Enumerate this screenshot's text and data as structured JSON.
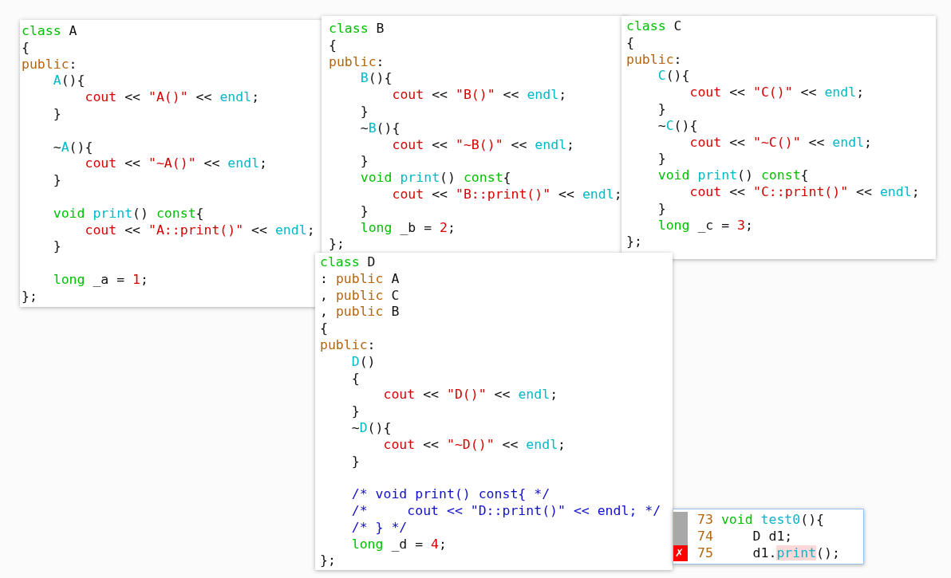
{
  "panels": [
    {
      "kind": "code",
      "lines": [
        {
          "kind": "code",
          "tokens": [
            {
              "kind": "kw",
              "text": "class"
            },
            {
              "kind": "pl",
              "text": " A"
            }
          ]
        },
        {
          "kind": "code",
          "tokens": [
            {
              "kind": "pl",
              "text": "{"
            }
          ]
        },
        {
          "kind": "code",
          "tokens": [
            {
              "kind": "acc",
              "text": "public"
            },
            {
              "kind": "pl",
              "text": ":"
            }
          ]
        },
        {
          "kind": "code",
          "tokens": [
            {
              "kind": "fn",
              "text": "    A"
            },
            {
              "kind": "pl",
              "text": "(){"
            }
          ]
        },
        {
          "kind": "code",
          "tokens": [
            {
              "kind": "str",
              "text": "        cout"
            },
            {
              "kind": "pl",
              "text": " << "
            },
            {
              "kind": "str",
              "text": "\"A()\""
            },
            {
              "kind": "pl",
              "text": " << "
            },
            {
              "kind": "fn",
              "text": "endl"
            },
            {
              "kind": "pl",
              "text": ";"
            }
          ]
        },
        {
          "kind": "code",
          "tokens": [
            {
              "kind": "pl",
              "text": "    }"
            }
          ]
        },
        {
          "kind": "blank"
        },
        {
          "kind": "code",
          "tokens": [
            {
              "kind": "pl",
              "text": "    ~"
            },
            {
              "kind": "fn",
              "text": "A"
            },
            {
              "kind": "pl",
              "text": "(){"
            }
          ]
        },
        {
          "kind": "code",
          "tokens": [
            {
              "kind": "str",
              "text": "        cout"
            },
            {
              "kind": "pl",
              "text": " << "
            },
            {
              "kind": "str",
              "text": "\"~A()\""
            },
            {
              "kind": "pl",
              "text": " << "
            },
            {
              "kind": "fn",
              "text": "endl"
            },
            {
              "kind": "pl",
              "text": ";"
            }
          ]
        },
        {
          "kind": "code",
          "tokens": [
            {
              "kind": "pl",
              "text": "    }"
            }
          ]
        },
        {
          "kind": "blank"
        },
        {
          "kind": "code",
          "tokens": [
            {
              "kind": "kw",
              "text": "    void "
            },
            {
              "kind": "fn",
              "text": "print"
            },
            {
              "kind": "pl",
              "text": "() "
            },
            {
              "kind": "kw",
              "text": "const"
            },
            {
              "kind": "pl",
              "text": "{"
            }
          ]
        },
        {
          "kind": "code",
          "tokens": [
            {
              "kind": "str",
              "text": "        cout"
            },
            {
              "kind": "pl",
              "text": " << "
            },
            {
              "kind": "str",
              "text": "\"A::print()\""
            },
            {
              "kind": "pl",
              "text": " << "
            },
            {
              "kind": "fn",
              "text": "endl"
            },
            {
              "kind": "pl",
              "text": ";"
            }
          ]
        },
        {
          "kind": "code",
          "tokens": [
            {
              "kind": "pl",
              "text": "    }"
            }
          ]
        },
        {
          "kind": "blank"
        },
        {
          "kind": "code",
          "tokens": [
            {
              "kind": "kw",
              "text": "    long"
            },
            {
              "kind": "pl",
              "text": " _a = "
            },
            {
              "kind": "str",
              "text": "1"
            },
            {
              "kind": "pl",
              "text": ";"
            }
          ]
        },
        {
          "kind": "code",
          "tokens": [
            {
              "kind": "pl",
              "text": "};"
            }
          ]
        }
      ]
    },
    {
      "kind": "code",
      "lines": [
        {
          "kind": "code",
          "tokens": [
            {
              "kind": "kw",
              "text": "class"
            },
            {
              "kind": "pl",
              "text": " B"
            }
          ]
        },
        {
          "kind": "code",
          "tokens": [
            {
              "kind": "pl",
              "text": "{"
            }
          ]
        },
        {
          "kind": "code",
          "tokens": [
            {
              "kind": "acc",
              "text": "public"
            },
            {
              "kind": "pl",
              "text": ":"
            }
          ]
        },
        {
          "kind": "code",
          "tokens": [
            {
              "kind": "fn",
              "text": "    B"
            },
            {
              "kind": "pl",
              "text": "(){"
            }
          ]
        },
        {
          "kind": "code",
          "tokens": [
            {
              "kind": "str",
              "text": "        cout"
            },
            {
              "kind": "pl",
              "text": " << "
            },
            {
              "kind": "str",
              "text": "\"B()\""
            },
            {
              "kind": "pl",
              "text": " << "
            },
            {
              "kind": "fn",
              "text": "endl"
            },
            {
              "kind": "pl",
              "text": ";"
            }
          ]
        },
        {
          "kind": "code",
          "tokens": [
            {
              "kind": "pl",
              "text": "    }"
            }
          ]
        },
        {
          "kind": "code",
          "tokens": [
            {
              "kind": "pl",
              "text": "    ~"
            },
            {
              "kind": "fn",
              "text": "B"
            },
            {
              "kind": "pl",
              "text": "(){"
            }
          ]
        },
        {
          "kind": "code",
          "tokens": [
            {
              "kind": "str",
              "text": "        cout"
            },
            {
              "kind": "pl",
              "text": " << "
            },
            {
              "kind": "str",
              "text": "\"~B()\""
            },
            {
              "kind": "pl",
              "text": " << "
            },
            {
              "kind": "fn",
              "text": "endl"
            },
            {
              "kind": "pl",
              "text": ";"
            }
          ]
        },
        {
          "kind": "code",
          "tokens": [
            {
              "kind": "pl",
              "text": "    }"
            }
          ]
        },
        {
          "kind": "code",
          "tokens": [
            {
              "kind": "kw",
              "text": "    void "
            },
            {
              "kind": "fn",
              "text": "print"
            },
            {
              "kind": "pl",
              "text": "() "
            },
            {
              "kind": "kw",
              "text": "const"
            },
            {
              "kind": "pl",
              "text": "{"
            }
          ]
        },
        {
          "kind": "code",
          "tokens": [
            {
              "kind": "str",
              "text": "        cout"
            },
            {
              "kind": "pl",
              "text": " << "
            },
            {
              "kind": "str",
              "text": "\"B::print()\""
            },
            {
              "kind": "pl",
              "text": " << "
            },
            {
              "kind": "fn",
              "text": "endl"
            },
            {
              "kind": "pl",
              "text": ";"
            }
          ]
        },
        {
          "kind": "code",
          "tokens": [
            {
              "kind": "pl",
              "text": "    }"
            }
          ]
        },
        {
          "kind": "code",
          "tokens": [
            {
              "kind": "kw",
              "text": "    long"
            },
            {
              "kind": "pl",
              "text": " _b = "
            },
            {
              "kind": "str",
              "text": "2"
            },
            {
              "kind": "pl",
              "text": ";"
            }
          ]
        },
        {
          "kind": "code",
          "tokens": [
            {
              "kind": "pl",
              "text": "};"
            }
          ]
        }
      ]
    },
    {
      "kind": "code",
      "lines": [
        {
          "kind": "code",
          "tokens": [
            {
              "kind": "kw",
              "text": "class"
            },
            {
              "kind": "pl",
              "text": " C"
            }
          ]
        },
        {
          "kind": "code",
          "tokens": [
            {
              "kind": "pl",
              "text": "{"
            }
          ]
        },
        {
          "kind": "code",
          "tokens": [
            {
              "kind": "acc",
              "text": "public"
            },
            {
              "kind": "pl",
              "text": ":"
            }
          ]
        },
        {
          "kind": "code",
          "tokens": [
            {
              "kind": "fn",
              "text": "    C"
            },
            {
              "kind": "pl",
              "text": "(){"
            }
          ]
        },
        {
          "kind": "code",
          "tokens": [
            {
              "kind": "str",
              "text": "        cout"
            },
            {
              "kind": "pl",
              "text": " << "
            },
            {
              "kind": "str",
              "text": "\"C()\""
            },
            {
              "kind": "pl",
              "text": " << "
            },
            {
              "kind": "fn",
              "text": "endl"
            },
            {
              "kind": "pl",
              "text": ";"
            }
          ]
        },
        {
          "kind": "code",
          "tokens": [
            {
              "kind": "pl",
              "text": "    }"
            }
          ]
        },
        {
          "kind": "code",
          "tokens": [
            {
              "kind": "pl",
              "text": "    ~"
            },
            {
              "kind": "fn",
              "text": "C"
            },
            {
              "kind": "pl",
              "text": "(){"
            }
          ]
        },
        {
          "kind": "code",
          "tokens": [
            {
              "kind": "str",
              "text": "        cout"
            },
            {
              "kind": "pl",
              "text": " << "
            },
            {
              "kind": "str",
              "text": "\"~C()\""
            },
            {
              "kind": "pl",
              "text": " << "
            },
            {
              "kind": "fn",
              "text": "endl"
            },
            {
              "kind": "pl",
              "text": ";"
            }
          ]
        },
        {
          "kind": "code",
          "tokens": [
            {
              "kind": "pl",
              "text": "    }"
            }
          ]
        },
        {
          "kind": "code",
          "tokens": [
            {
              "kind": "kw",
              "text": "    void "
            },
            {
              "kind": "fn",
              "text": "print"
            },
            {
              "kind": "pl",
              "text": "() "
            },
            {
              "kind": "kw",
              "text": "const"
            },
            {
              "kind": "pl",
              "text": "{"
            }
          ]
        },
        {
          "kind": "code",
          "tokens": [
            {
              "kind": "str",
              "text": "        cout"
            },
            {
              "kind": "pl",
              "text": " << "
            },
            {
              "kind": "str",
              "text": "\"C::print()\""
            },
            {
              "kind": "pl",
              "text": " << "
            },
            {
              "kind": "fn",
              "text": "endl"
            },
            {
              "kind": "pl",
              "text": ";"
            }
          ]
        },
        {
          "kind": "code",
          "tokens": [
            {
              "kind": "pl",
              "text": "    }"
            }
          ]
        },
        {
          "kind": "code",
          "tokens": [
            {
              "kind": "kw",
              "text": "    long"
            },
            {
              "kind": "pl",
              "text": " _c = "
            },
            {
              "kind": "str",
              "text": "3"
            },
            {
              "kind": "pl",
              "text": ";"
            }
          ]
        },
        {
          "kind": "code",
          "tokens": [
            {
              "kind": "pl",
              "text": "};"
            }
          ]
        }
      ]
    },
    {
      "kind": "code",
      "lines": [
        {
          "kind": "code",
          "tokens": [
            {
              "kind": "kw",
              "text": "class"
            },
            {
              "kind": "pl",
              "text": " D"
            }
          ]
        },
        {
          "kind": "code",
          "tokens": [
            {
              "kind": "pl",
              "text": ": "
            },
            {
              "kind": "acc",
              "text": "public"
            },
            {
              "kind": "pl",
              "text": " A"
            }
          ]
        },
        {
          "kind": "code",
          "tokens": [
            {
              "kind": "pl",
              "text": ", "
            },
            {
              "kind": "acc",
              "text": "public"
            },
            {
              "kind": "pl",
              "text": " C"
            }
          ]
        },
        {
          "kind": "code",
          "tokens": [
            {
              "kind": "pl",
              "text": ", "
            },
            {
              "kind": "acc",
              "text": "public"
            },
            {
              "kind": "pl",
              "text": " B"
            }
          ]
        },
        {
          "kind": "code",
          "tokens": [
            {
              "kind": "pl",
              "text": "{"
            }
          ]
        },
        {
          "kind": "code",
          "tokens": [
            {
              "kind": "acc",
              "text": "public"
            },
            {
              "kind": "pl",
              "text": ":"
            }
          ]
        },
        {
          "kind": "code",
          "tokens": [
            {
              "kind": "fn",
              "text": "    D"
            },
            {
              "kind": "pl",
              "text": "()"
            }
          ]
        },
        {
          "kind": "code",
          "tokens": [
            {
              "kind": "pl",
              "text": "    {"
            }
          ]
        },
        {
          "kind": "code",
          "tokens": [
            {
              "kind": "str",
              "text": "        cout"
            },
            {
              "kind": "pl",
              "text": " << "
            },
            {
              "kind": "str",
              "text": "\"D()\""
            },
            {
              "kind": "pl",
              "text": " << "
            },
            {
              "kind": "fn",
              "text": "endl"
            },
            {
              "kind": "pl",
              "text": ";"
            }
          ]
        },
        {
          "kind": "code",
          "tokens": [
            {
              "kind": "pl",
              "text": "    }"
            }
          ]
        },
        {
          "kind": "code",
          "tokens": [
            {
              "kind": "pl",
              "text": "    ~"
            },
            {
              "kind": "fn",
              "text": "D"
            },
            {
              "kind": "pl",
              "text": "(){"
            }
          ]
        },
        {
          "kind": "code",
          "tokens": [
            {
              "kind": "str",
              "text": "        cout"
            },
            {
              "kind": "pl",
              "text": " << "
            },
            {
              "kind": "str",
              "text": "\"~D()\""
            },
            {
              "kind": "pl",
              "text": " << "
            },
            {
              "kind": "fn",
              "text": "endl"
            },
            {
              "kind": "pl",
              "text": ";"
            }
          ]
        },
        {
          "kind": "code",
          "tokens": [
            {
              "kind": "pl",
              "text": "    }"
            }
          ]
        },
        {
          "kind": "blank"
        },
        {
          "kind": "code",
          "tokens": [
            {
              "kind": "cm",
              "text": "    /* void print() const{ */"
            }
          ]
        },
        {
          "kind": "code",
          "tokens": [
            {
              "kind": "cm",
              "text": "    /*     cout << \"D::print()\" << endl; */"
            }
          ]
        },
        {
          "kind": "code",
          "tokens": [
            {
              "kind": "cm",
              "text": "    /* } */"
            }
          ]
        },
        {
          "kind": "code",
          "tokens": [
            {
              "kind": "kw",
              "text": "    long"
            },
            {
              "kind": "pl",
              "text": " _d = "
            },
            {
              "kind": "str",
              "text": "4"
            },
            {
              "kind": "pl",
              "text": ";"
            }
          ]
        },
        {
          "kind": "code",
          "tokens": [
            {
              "kind": "pl",
              "text": "};"
            }
          ]
        }
      ]
    },
    {
      "kind": "editor",
      "lines": [
        {
          "number": "73",
          "error": false,
          "tokens": [
            {
              "kind": "kw",
              "text": "void "
            },
            {
              "kind": "fn",
              "text": "test0"
            },
            {
              "kind": "pl",
              "text": "(){"
            }
          ]
        },
        {
          "number": "74",
          "error": false,
          "tokens": [
            {
              "kind": "pl",
              "text": "    D d1;"
            }
          ]
        },
        {
          "number": "75",
          "error": true,
          "marker": "✗",
          "tokens": [
            {
              "kind": "pl",
              "text": "    d1."
            },
            {
              "kind": "err",
              "text": "print"
            },
            {
              "kind": "pl",
              "text": "();"
            }
          ]
        }
      ]
    }
  ]
}
